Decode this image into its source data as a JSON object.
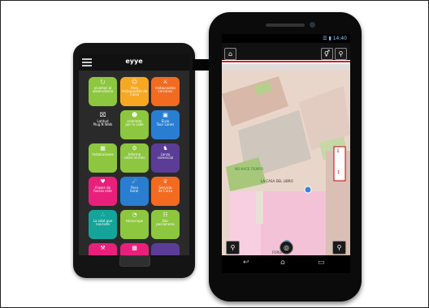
{
  "app_title": "eyye",
  "left_tiles": [
    {
      "label": "vivamos al\nobservatorio",
      "color": "#8dc63f",
      "icon": "wifi-icon",
      "glyph": "⭮"
    },
    {
      "label": "Para\nrestaurantes de\nCaixa",
      "color": "#f7a823",
      "icon": "coin-icon",
      "glyph": "☺"
    },
    {
      "label": "restaurantes\ncercanos",
      "color": "#f26b21",
      "icon": "cutlery-icon",
      "glyph": "⚔"
    },
    {
      "label": "Latitud\nPlug N Walk",
      "color": "#2a2a2a",
      "icon": "laptop-icon",
      "glyph": "⌧"
    },
    {
      "label": "orientate\npor la calle",
      "color": "#8dc63f",
      "icon": "people-icon",
      "glyph": "☻"
    },
    {
      "label": "Eixlo\nTour Lanes",
      "color": "#2a7ed2",
      "icon": "bus-icon",
      "glyph": "▣"
    },
    {
      "label": "Instalaciones",
      "color": "#8dc63f",
      "icon": "building-icon",
      "glyph": "▦"
    },
    {
      "label": "Informe\nsobre el mes",
      "color": "#8dc63f",
      "icon": "gear-icon",
      "glyph": "⚙"
    },
    {
      "label": "Lanzo\ncomercial",
      "color": "#5b3d97",
      "icon": "pedestrian-icon",
      "glyph": "♞"
    },
    {
      "label": "Frases de\nfuerza este",
      "color": "#e8207c",
      "icon": "heart-icon",
      "glyph": "♥"
    },
    {
      "label": "Para\nllorar",
      "color": "#2a7ed2",
      "icon": "wifi-signal-icon",
      "glyph": "☄"
    },
    {
      "label": "Servicio\nde Caixa",
      "color": "#f26b21",
      "icon": "grad-cap-icon",
      "glyph": "♕"
    },
    {
      "label": "La edat que\nnecesite",
      "color": "#14a49a",
      "icon": "nodes-icon",
      "glyph": "∴"
    },
    {
      "label": "Horoscope",
      "color": "#8dc63f",
      "icon": "clock-icon",
      "glyph": "◔"
    },
    {
      "label": "Dar\nposnorama",
      "color": "#8dc63f",
      "icon": "chat-icon",
      "glyph": "☷"
    },
    {
      "label": "",
      "color": "#e8207c",
      "icon": "pin-icon",
      "glyph": "⚒"
    },
    {
      "label": "",
      "color": "#e8207c",
      "icon": "tv-icon",
      "glyph": "▩"
    },
    {
      "label": "",
      "color": "#5b3d97",
      "icon": "blank-icon",
      "glyph": ""
    }
  ],
  "status_time": "14:40",
  "map_labels": {
    "store_green": "NO HACE TIEMPO",
    "book_house": "LA CASA DEL LIBRO",
    "forum": "FORUM",
    "floor_badge": "1",
    "floor_label": "1"
  },
  "nav_icons": [
    "back-icon",
    "home-icon",
    "recent-apps-icon"
  ]
}
